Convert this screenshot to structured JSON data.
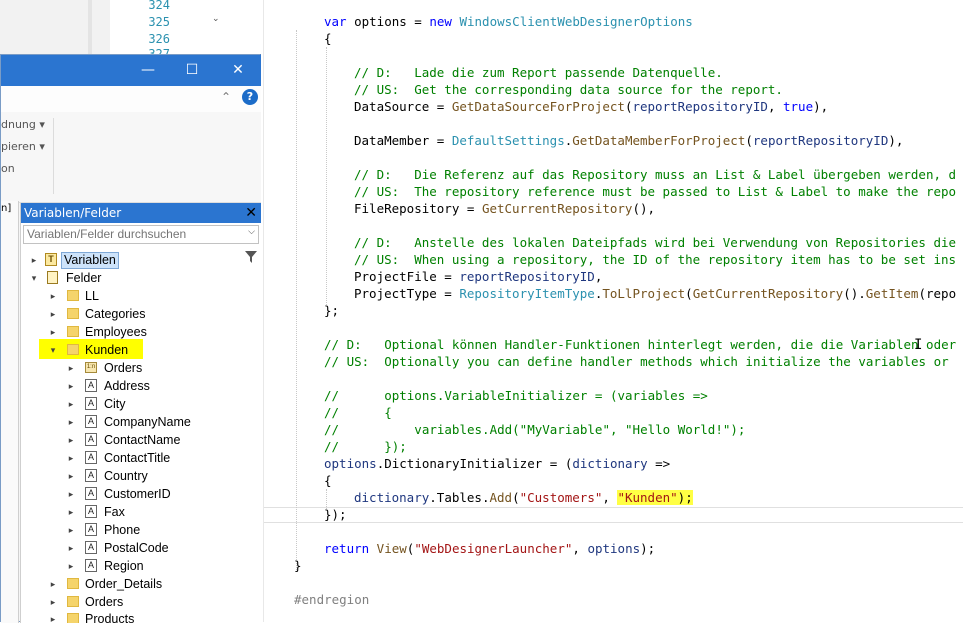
{
  "editor": {
    "line_numbers": [
      "324",
      "325",
      "326",
      "327"
    ],
    "code": {
      "l1_kw": "var",
      "l1_rest": " options = ",
      "l1_new": "new",
      "l1_cls": "WindowsClientWebDesignerOptions",
      "brace_open": "{",
      "c1": "// D:   Lade die zum Report passende Datenquelle.",
      "c2": "// US:  Get the corresponding data source for the report.",
      "ds_a": "DataSource = ",
      "ds_m": "GetDataSourceForProject",
      "ds_b": "(",
      "ds_p": "reportRepositoryID",
      "ds_c": ", ",
      "ds_t": "true",
      "ds_d": "),",
      "dm_a": "DataMember = ",
      "dm_cls": "DefaultSettings",
      "dm_b": ".",
      "dm_m": "GetDataMemberForProject",
      "dm_c": "(",
      "dm_p": "reportRepositoryID",
      "dm_d": "),",
      "c3": "// D:   Die Referenz auf das Repository muss an List & Label übergeben werden, d",
      "c4": "// US:  The repository reference must be passed to List & Label to make the repo",
      "fr_a": "FileRepository = ",
      "fr_m": "GetCurrentRepository",
      "fr_b": "(),",
      "c5": "// D:   Anstelle des lokalen Dateipfads wird bei Verwendung von Repositories die",
      "c6": "// US:  When using a repository, the ID of the repository item has to be set ins",
      "pf_a": "ProjectFile = ",
      "pf_p": "reportRepositoryID",
      "pf_b": ",",
      "pt_a": "ProjectType = ",
      "pt_cls": "RepositoryItemType",
      "pt_b": ".",
      "pt_m": "ToLlProject",
      "pt_c": "(",
      "pt_m2": "GetCurrentRepository",
      "pt_d": "().",
      "pt_m3": "GetItem",
      "pt_e": "(repo",
      "close1": "};",
      "c7": "// D:   Optional können Handler-Funktionen hinterlegt werden, die die Variablen oder",
      "c8": "// US:  Optionally you can define handler methods which initialize the variables or",
      "c9": "//      options.VariableInitializer = (variables =>",
      "c10": "//      {",
      "c11": "//          variables.Add(\"MyVariable\", \"Hello World!\");",
      "c12": "//      });",
      "di_a": "options",
      "di_b": ".DictionaryInitializer = (",
      "di_p": "dictionary",
      "di_c": " =>",
      "brace2": "{",
      "ta_p": "dictionary",
      "ta_b": ".Tables.",
      "ta_m": "Add",
      "ta_c": "(",
      "ta_s1": "\"Customers\"",
      "ta_d": ", ",
      "ta_s2": "\"Kunden\"",
      "ta_e": ");",
      "close2": "});",
      "ret_kw": "return",
      "ret_m": " View",
      "ret_a": "(",
      "ret_s": "\"WebDesignerLauncher\"",
      "ret_b": ", ",
      "ret_p": "options",
      "ret_c": ");",
      "close3": "}",
      "endregion": "#endregion"
    }
  },
  "window": {
    "minimize": "—",
    "maximize": "☐",
    "close": "✕",
    "ribbon_items": [
      "dnung ▾",
      "pieren ▾",
      "on"
    ],
    "strip_label": "n]",
    "help": "?"
  },
  "panel": {
    "title": "Variablen/Felder",
    "search_placeholder": "Variablen/Felder durchsuchen",
    "tree": {
      "variablen": "Variablen",
      "felder": "Felder",
      "ll": "LL",
      "categories": "Categories",
      "employees": "Employees",
      "kunden": "Kunden",
      "fields": [
        "Orders",
        "Address",
        "City",
        "CompanyName",
        "ContactName",
        "ContactTitle",
        "Country",
        "CustomerID",
        "Fax",
        "Phone",
        "PostalCode",
        "Region"
      ],
      "order_details": "Order_Details",
      "orders": "Orders",
      "products": "Products"
    }
  },
  "colors": {
    "title_bar": "#2b75d0",
    "highlight": "#ffff00",
    "keyword": "#0000ff",
    "comment": "#008000",
    "string": "#a31515",
    "type": "#2b91af"
  }
}
